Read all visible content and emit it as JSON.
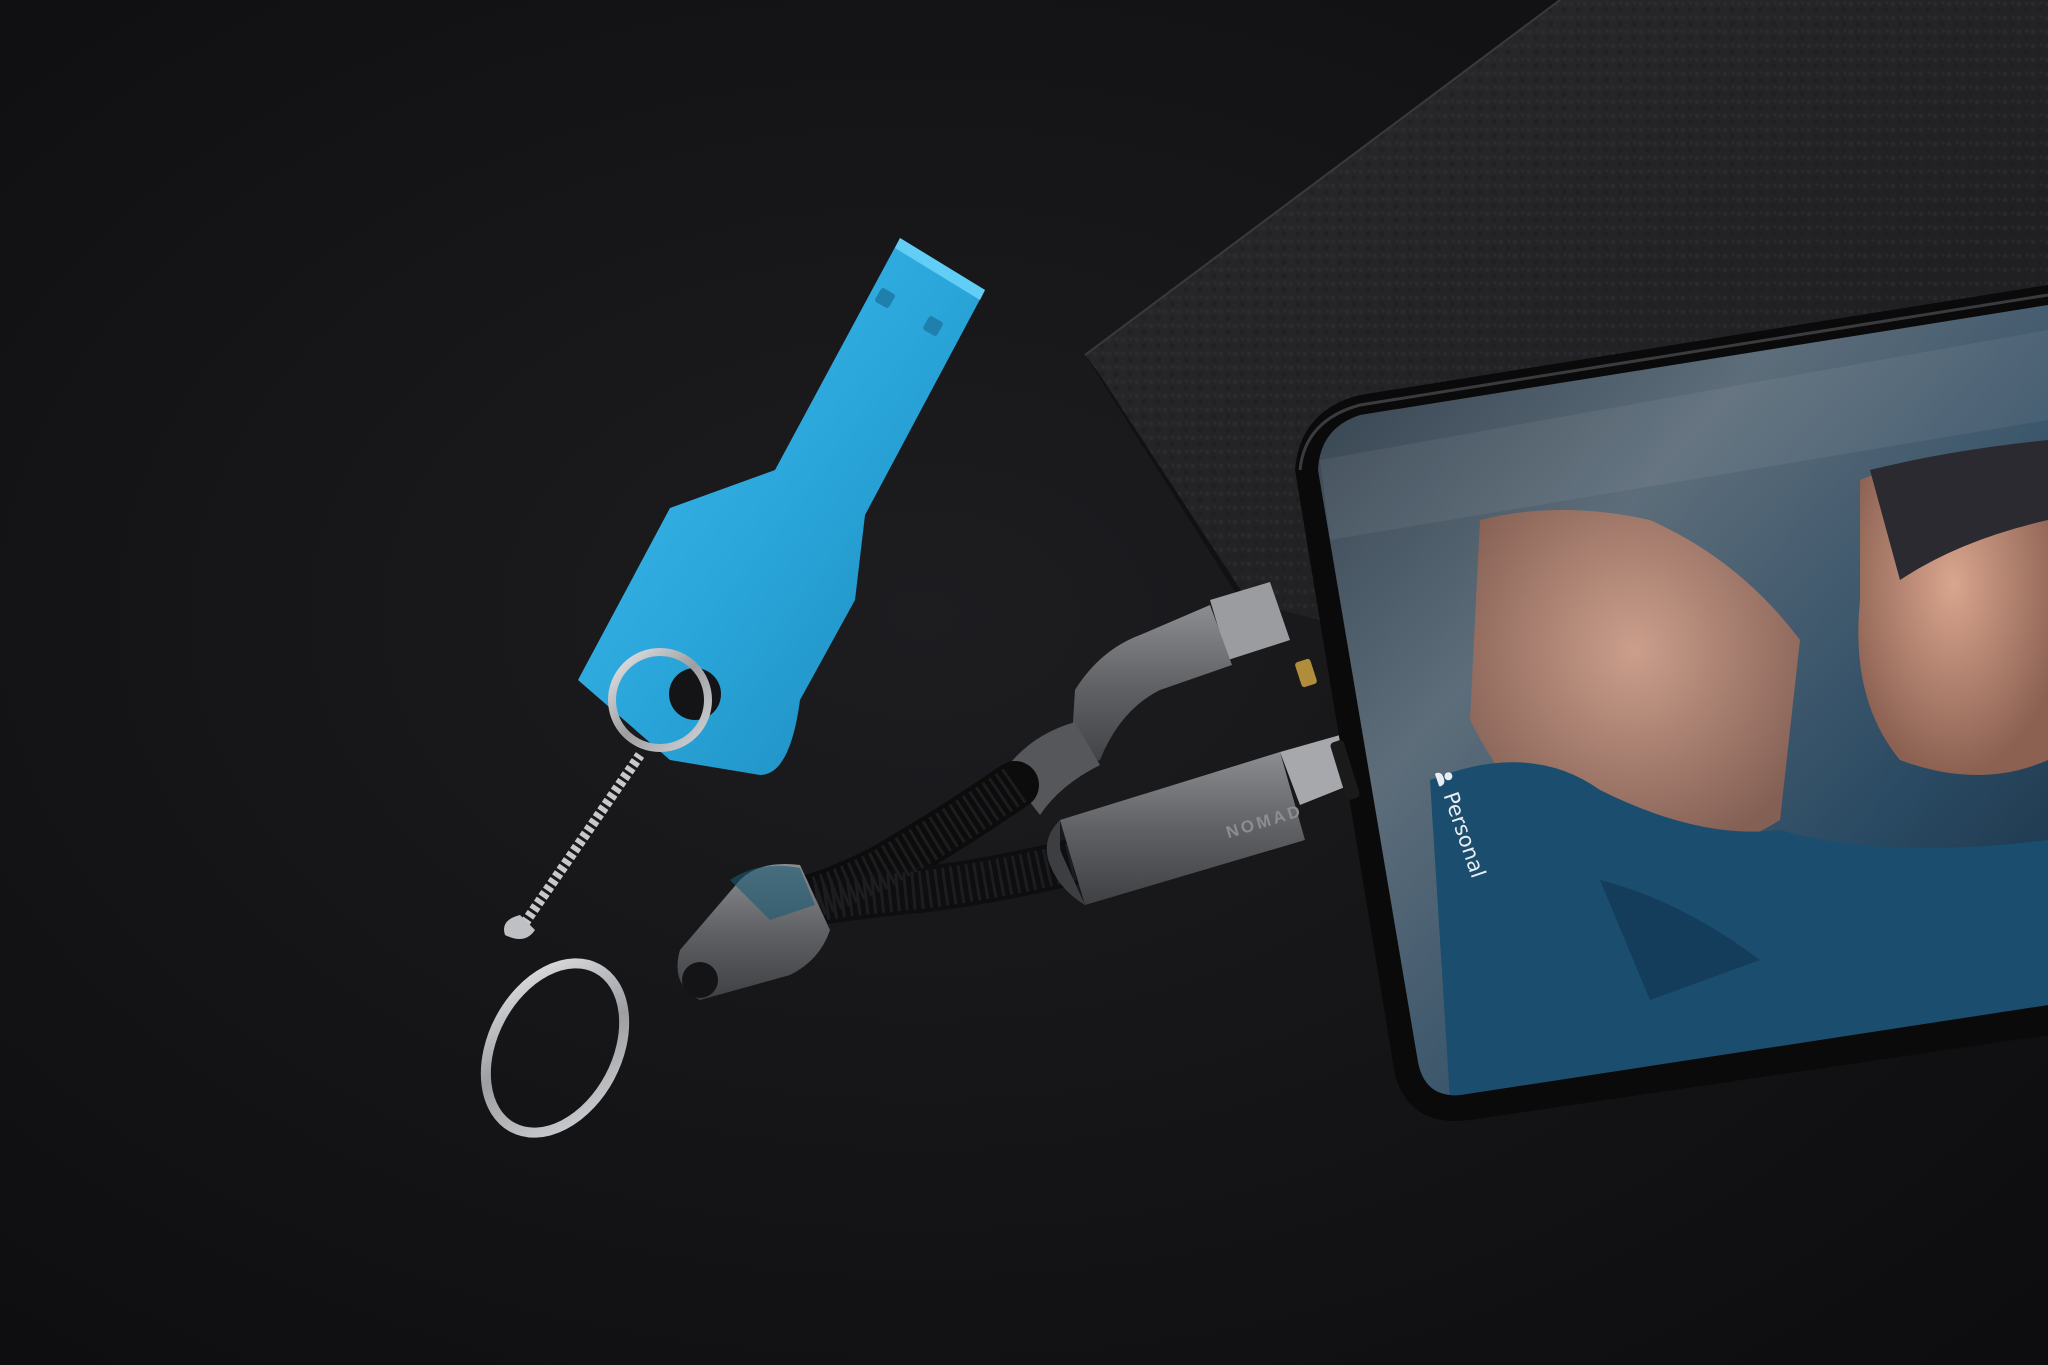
{
  "scene": {
    "description_colors": {
      "background": "#141416",
      "usb_key": "#2ba7dc",
      "leather_case": "#232325",
      "cable_metal": "#6f7174",
      "phone_frame": "#0b0b0c"
    }
  },
  "cable": {
    "brand": "NOMAD"
  },
  "phone": {
    "focus_mode_label": "Personal",
    "focus_icon": "person-icon"
  }
}
